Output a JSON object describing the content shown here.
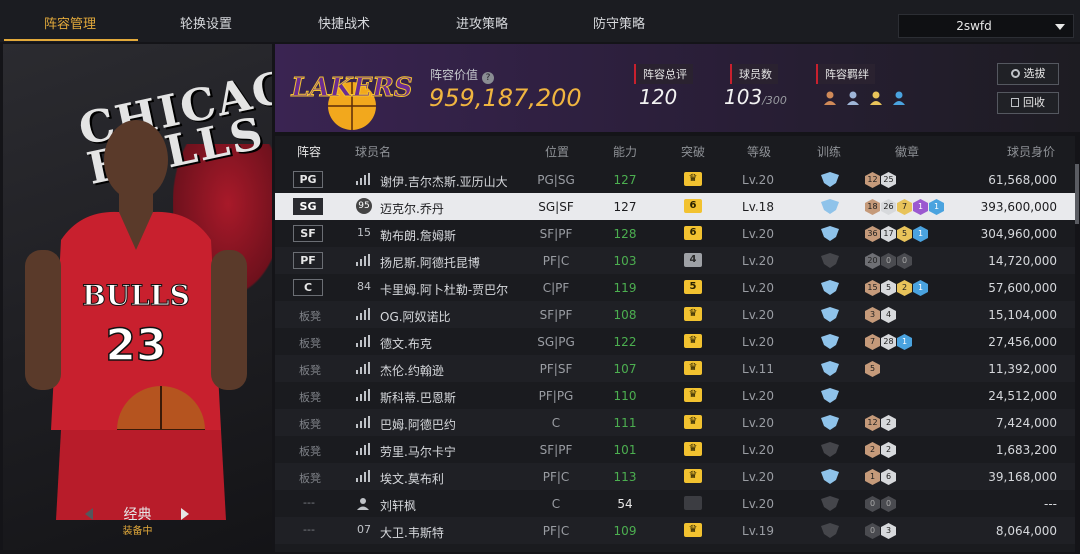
{
  "nav": {
    "tabs": [
      {
        "label": "阵容管理",
        "active": true
      },
      {
        "label": "轮换设置",
        "active": false
      },
      {
        "label": "快捷战术",
        "active": false
      },
      {
        "label": "进攻策略",
        "active": false
      },
      {
        "label": "防守策略",
        "active": false
      }
    ],
    "account_select": "2swfd"
  },
  "left_panel": {
    "jersey_text": "CHICAGO BULLS",
    "mode_label": "经典",
    "mode_status": "装备中"
  },
  "header": {
    "team_logo_text": "LAKERS",
    "lineup_value_label": "阵容价值",
    "lineup_value": "959,187,200",
    "overall_label": "阵容总评",
    "overall_value": "120",
    "player_count_label": "球员数",
    "player_count": "103",
    "player_count_max": "/300",
    "bond_label": "阵容羁绊",
    "bond_colors": [
      "#d08a58",
      "#9fb6d8",
      "#e8c35a",
      "#4aa3df"
    ],
    "select_button": "选拔",
    "recycle_button": "回收"
  },
  "table": {
    "columns": [
      "阵容",
      "球员名",
      "位置",
      "能力",
      "突破",
      "等级",
      "训练",
      "徽章",
      "球员身价"
    ],
    "rows": [
      {
        "slot": "PG",
        "slot_type": "starter",
        "icon": "bars",
        "name": "谢伊.吉尔杰斯.亚历山大",
        "position": "PG|SG",
        "ability": "127",
        "ability_color": "green",
        "breakthrough": "",
        "break_style": "gold-crown",
        "level": "Lv.20",
        "train": "blue",
        "badges": [
          [
            "12",
            "bronze"
          ],
          [
            "25",
            "silver"
          ]
        ],
        "price": "61,568,000"
      },
      {
        "slot": "SG",
        "slot_type": "starter",
        "icon": "95",
        "name": "迈克尔.乔丹",
        "position": "SG|SF",
        "ability": "127",
        "ability_color": "white",
        "breakthrough": "6",
        "break_style": "gold",
        "level": "Lv.18",
        "train": "blue",
        "badges": [
          [
            "18",
            "bronze"
          ],
          [
            "26",
            "silver"
          ],
          [
            "7",
            "gold"
          ],
          [
            "1",
            "purple"
          ],
          [
            "1",
            "blue"
          ]
        ],
        "price": "393,600,000",
        "selected": true
      },
      {
        "slot": "SF",
        "slot_type": "starter",
        "icon": "15",
        "name": "勒布朗.詹姆斯",
        "position": "SF|PF",
        "ability": "128",
        "ability_color": "green",
        "breakthrough": "6",
        "break_style": "gold",
        "level": "Lv.20",
        "train": "blue",
        "badges": [
          [
            "36",
            "bronze"
          ],
          [
            "17",
            "silver"
          ],
          [
            "5",
            "gold"
          ],
          [
            "1",
            "blue"
          ]
        ],
        "price": "304,960,000"
      },
      {
        "slot": "PF",
        "slot_type": "starter",
        "icon": "bars",
        "name": "扬尼斯.阿德托昆博",
        "position": "PF|C",
        "ability": "103",
        "ability_color": "green",
        "breakthrough": "4",
        "break_style": "grey",
        "level": "Lv.20",
        "train": "off",
        "badges": [
          [
            "20",
            "ash"
          ],
          [
            "0",
            "dark"
          ],
          [
            "0",
            "dark"
          ]
        ],
        "price": "14,720,000"
      },
      {
        "slot": "C",
        "slot_type": "starter",
        "icon": "84",
        "name": "卡里姆.阿卜杜勒-贾巴尔",
        "position": "C|PF",
        "ability": "119",
        "ability_color": "green",
        "breakthrough": "5",
        "break_style": "gold",
        "level": "Lv.20",
        "train": "blue",
        "badges": [
          [
            "15",
            "bronze"
          ],
          [
            "5",
            "silver"
          ],
          [
            "2",
            "gold"
          ],
          [
            "1",
            "blue"
          ]
        ],
        "price": "57,600,000"
      },
      {
        "slot": "板凳",
        "slot_type": "bench",
        "icon": "bars",
        "name": "OG.阿奴诺比",
        "position": "SF|PF",
        "ability": "108",
        "ability_color": "green",
        "breakthrough": "",
        "break_style": "gold-crown",
        "level": "Lv.20",
        "train": "blue",
        "badges": [
          [
            "3",
            "bronze"
          ],
          [
            "4",
            "silver"
          ]
        ],
        "price": "15,104,000"
      },
      {
        "slot": "板凳",
        "slot_type": "bench",
        "icon": "bars",
        "name": "德文.布克",
        "position": "SG|PG",
        "ability": "122",
        "ability_color": "green",
        "breakthrough": "",
        "break_style": "gold-crown",
        "level": "Lv.20",
        "train": "blue",
        "badges": [
          [
            "7",
            "bronze"
          ],
          [
            "28",
            "silver"
          ],
          [
            "1",
            "blue"
          ]
        ],
        "price": "27,456,000"
      },
      {
        "slot": "板凳",
        "slot_type": "bench",
        "icon": "bars",
        "name": "杰伦.约翰逊",
        "position": "PF|SF",
        "ability": "107",
        "ability_color": "green",
        "breakthrough": "",
        "break_style": "gold-crown",
        "level": "Lv.11",
        "train": "blue",
        "badges": [
          [
            "5",
            "bronze"
          ]
        ],
        "price": "11,392,000"
      },
      {
        "slot": "板凳",
        "slot_type": "bench",
        "icon": "bars",
        "name": "斯科蒂.巴恩斯",
        "position": "PF|PG",
        "ability": "110",
        "ability_color": "green",
        "breakthrough": "",
        "break_style": "gold-crown",
        "level": "Lv.20",
        "train": "blue",
        "badges": [],
        "price": "24,512,000"
      },
      {
        "slot": "板凳",
        "slot_type": "bench",
        "icon": "bars",
        "name": "巴姆.阿德巴约",
        "position": "C",
        "ability": "111",
        "ability_color": "green",
        "breakthrough": "",
        "break_style": "gold-crown",
        "level": "Lv.20",
        "train": "blue",
        "badges": [
          [
            "12",
            "bronze"
          ],
          [
            "2",
            "silver"
          ]
        ],
        "price": "7,424,000"
      },
      {
        "slot": "板凳",
        "slot_type": "bench",
        "icon": "bars",
        "name": "劳里.马尔卡宁",
        "position": "SF|PF",
        "ability": "101",
        "ability_color": "green",
        "breakthrough": "",
        "break_style": "gold-crown",
        "level": "Lv.20",
        "train": "off",
        "badges": [
          [
            "2",
            "bronze"
          ],
          [
            "2",
            "silver"
          ]
        ],
        "price": "1,683,200"
      },
      {
        "slot": "板凳",
        "slot_type": "bench",
        "icon": "bars",
        "name": "埃文.莫布利",
        "position": "PF|C",
        "ability": "113",
        "ability_color": "green",
        "breakthrough": "",
        "break_style": "gold-crown",
        "level": "Lv.20",
        "train": "blue",
        "badges": [
          [
            "1",
            "bronze"
          ],
          [
            "6",
            "silver"
          ]
        ],
        "price": "39,168,000"
      },
      {
        "slot": "---",
        "slot_type": "none",
        "icon": "person",
        "name": "刘轩枫",
        "position": "C",
        "ability": "54",
        "ability_color": "white",
        "breakthrough": "",
        "break_style": "off",
        "level": "Lv.20",
        "train": "off",
        "badges": [
          [
            "0",
            "dark"
          ],
          [
            "0",
            "dark"
          ]
        ],
        "price": "---"
      },
      {
        "slot": "---",
        "slot_type": "none",
        "icon": "07",
        "name": "大卫.韦斯特",
        "position": "PF|C",
        "ability": "109",
        "ability_color": "green",
        "breakthrough": "",
        "break_style": "gold-crown",
        "level": "Lv.19",
        "train": "off",
        "badges": [
          [
            "0",
            "dark"
          ],
          [
            "3",
            "silver"
          ]
        ],
        "price": "8,064,000"
      }
    ]
  }
}
